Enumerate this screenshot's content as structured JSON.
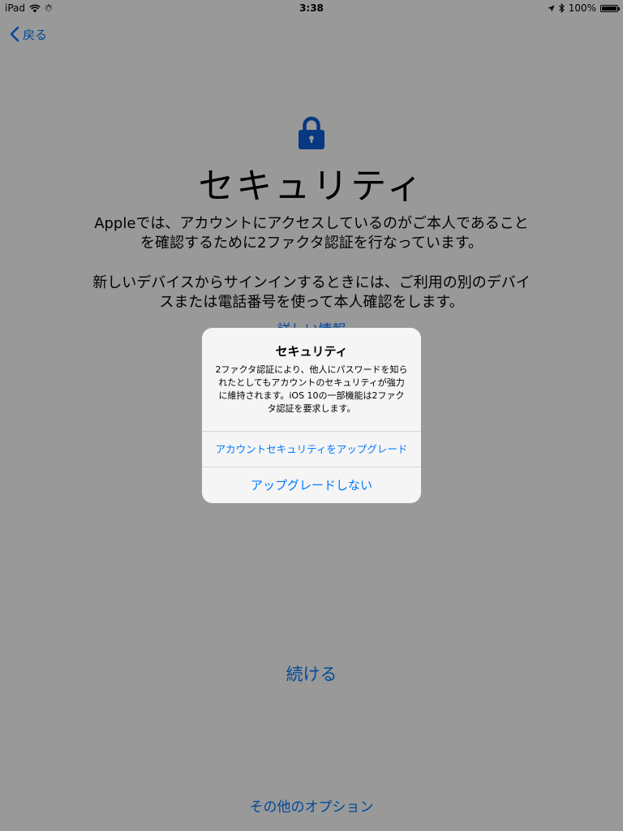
{
  "status_bar": {
    "device": "iPad",
    "time": "3:38",
    "battery": "100%"
  },
  "nav": {
    "back_label": "戻る"
  },
  "main": {
    "title": "セキュリティ",
    "description_1": "Appleでは、アカウントにアクセスしているのがご本人であることを確認するために2ファクタ認証を行なっています。",
    "description_2": "新しいデバイスからサインインするときには、ご利用の別のデバイスまたは電話番号を使って本人確認をします。",
    "more_info_label": "詳しい情報",
    "continue_label": "続ける",
    "other_options_label": "その他のオプション"
  },
  "alert": {
    "title": "セキュリティ",
    "message": "2ファクタ認証により、他人にパスワードを知られたとしてもアカウントのセキュリティが強力に維持されます。iOS 10の一部機能は2ファクタ認証を要求します。",
    "upgrade_label": "アカウントセキュリティをアップグレード",
    "no_upgrade_label": "アップグレードしない"
  },
  "colors": {
    "accent": "#007aff",
    "lock": "#0a5fd6",
    "overlay": "rgba(0,0,0,0.4)"
  },
  "icons": [
    "wifi-icon",
    "activity-spinner-icon",
    "location-arrow-icon",
    "bluetooth-icon",
    "battery-icon",
    "chevron-left-icon",
    "lock-icon"
  ]
}
